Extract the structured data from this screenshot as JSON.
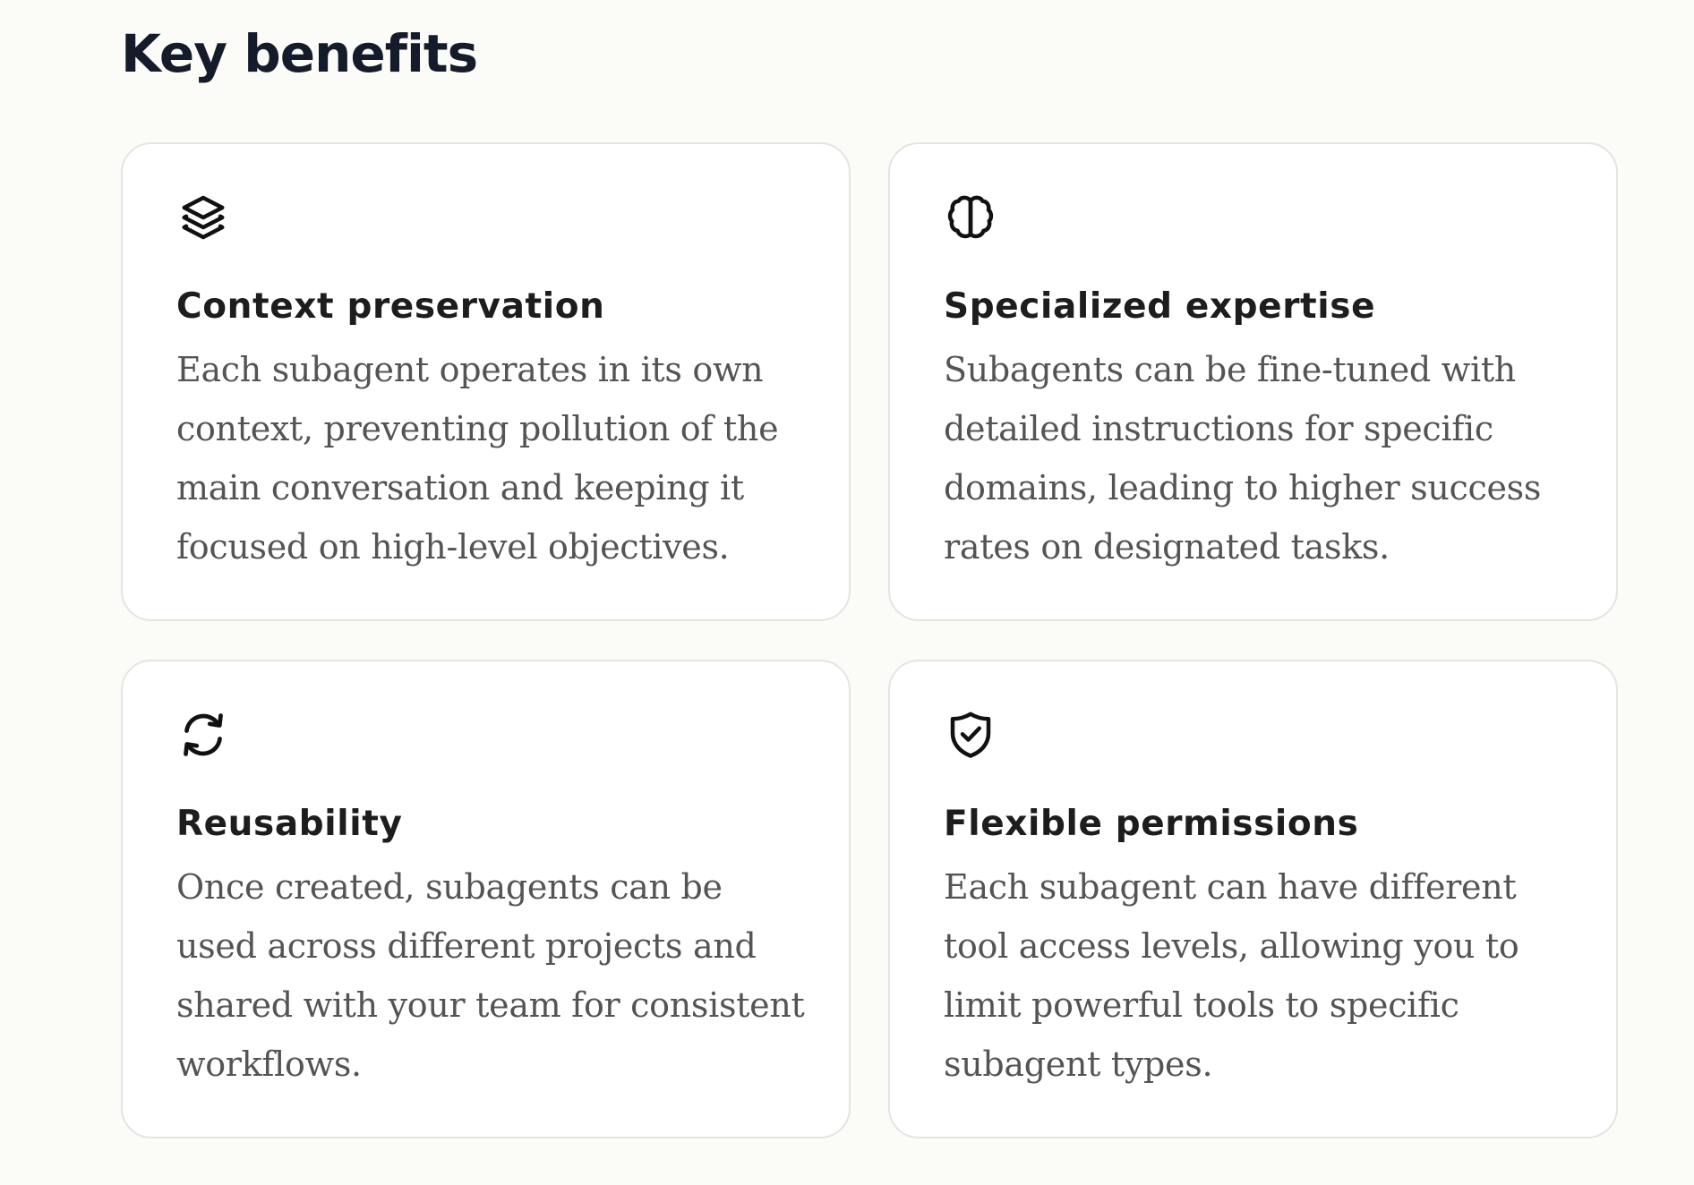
{
  "section": {
    "title": "Key benefits"
  },
  "cards": [
    {
      "icon": "layers-icon",
      "title": "Context preservation",
      "description": "Each subagent operates in its own context, preventing pollution of the main conversation and keeping it focused on high-level objectives."
    },
    {
      "icon": "brain-icon",
      "title": "Specialized expertise",
      "description": "Subagents can be fine-tuned with detailed instructions for specific domains, leading to higher success rates on designated tasks."
    },
    {
      "icon": "refresh-icon",
      "title": "Reusability",
      "description": "Once created, subagents can be used across different projects and shared with your team for consistent workflows."
    },
    {
      "icon": "shield-check-icon",
      "title": "Flexible permissions",
      "description": "Each subagent can have different tool access levels, allowing you to limit powerful tools to specific subagent types."
    }
  ],
  "colors": {
    "background": "#fbfbf7",
    "card_background": "#ffffff",
    "card_border": "#e4e4e0",
    "heading": "#141b2b",
    "card_title": "#1d1d1d",
    "body_text": "#545454",
    "icon": "#111111"
  }
}
